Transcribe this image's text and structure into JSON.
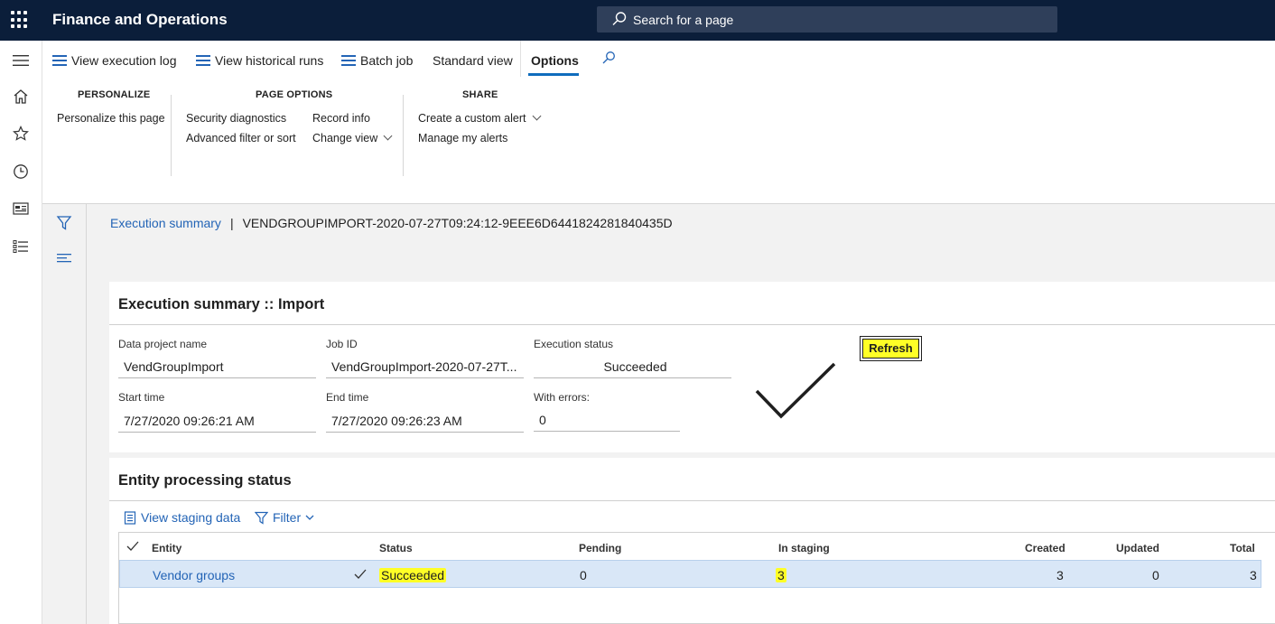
{
  "topbar": {
    "app_title": "Finance and Operations",
    "search_placeholder": "Search for a page"
  },
  "leftrail": {
    "icons": [
      "menu-icon",
      "home-icon",
      "star-icon",
      "recent-icon",
      "workspace-icon",
      "list-icon"
    ]
  },
  "actionbar": {
    "view_execution_log": "View execution log",
    "view_historical_runs": "View historical runs",
    "batch_job": "Batch job",
    "standard_view": "Standard view",
    "options": "Options"
  },
  "ribbon": {
    "personalize_title": "PERSONALIZE",
    "personalize_this_page": "Personalize this page",
    "page_options_title": "PAGE OPTIONS",
    "security_diagnostics": "Security diagnostics",
    "advanced_filter": "Advanced filter or sort",
    "record_info": "Record info",
    "change_view": "Change view",
    "share_title": "SHARE",
    "create_custom_alert": "Create a custom alert",
    "manage_alerts": "Manage my alerts"
  },
  "breadcrumb": {
    "link": "Execution summary",
    "separator": "|",
    "current": "VENDGROUPIMPORT-2020-07-27T09:24:12-9EEE6D6441824281840435D"
  },
  "summary": {
    "title": "Execution summary :: Import",
    "data_project_label": "Data project name",
    "data_project_value": "VendGroupImport",
    "job_id_label": "Job ID",
    "job_id_value": "VendGroupImport-2020-07-27T...",
    "execution_status_label": "Execution status",
    "execution_status_value": "Succeeded",
    "start_time_label": "Start time",
    "start_time_value": "7/27/2020 09:26:21 AM",
    "end_time_label": "End time",
    "end_time_value": "7/27/2020 09:26:23 AM",
    "with_errors_label": "With errors:",
    "with_errors_value": "0",
    "refresh_label": "Refresh"
  },
  "entity_status": {
    "title": "Entity processing status",
    "view_staging": "View staging data",
    "filter": "Filter",
    "columns": {
      "entity": "Entity",
      "status": "Status",
      "pending": "Pending",
      "in_staging": "In staging",
      "created": "Created",
      "updated": "Updated",
      "total": "Total"
    },
    "rows": [
      {
        "entity": "Vendor groups",
        "status": "Succeeded",
        "pending": "0",
        "in_staging": "3",
        "created": "3",
        "updated": "0",
        "total": "3"
      }
    ]
  },
  "colors": {
    "nav_bg": "#0b1e3a",
    "accent": "#2364b6",
    "highlight": "#ffff26",
    "selected_row": "#d9e7f7"
  }
}
